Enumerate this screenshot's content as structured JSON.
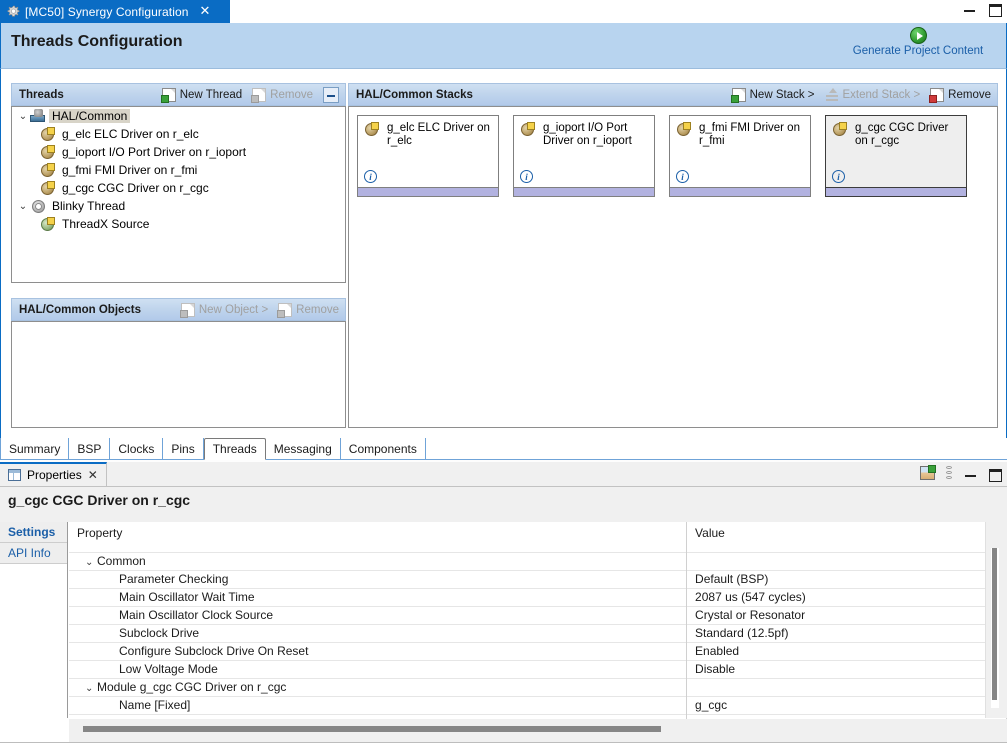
{
  "window": {
    "tab_title": "[MC50] Synergy Configuration",
    "tab_icon": "gear-icon",
    "close_glyph": "✕",
    "minimize_label": "Minimize",
    "maximize_label": "Maximize"
  },
  "header": {
    "title": "Threads Configuration",
    "generate_link": "Generate Project Content",
    "generate_icon": "play-circle-icon"
  },
  "threads_panel": {
    "title": "Threads",
    "new_button": "New Thread",
    "remove_button": "Remove",
    "collapse_button": "collapse",
    "tree": [
      {
        "label": "HAL/Common",
        "level": 0,
        "twisty": "⌄",
        "icon": "hal-common-icon",
        "selected": true
      },
      {
        "label": "g_elc ELC Driver on r_elc",
        "level": 1,
        "twisty": "",
        "icon": "module-icon",
        "selected": false
      },
      {
        "label": "g_ioport I/O Port Driver on r_ioport",
        "level": 1,
        "twisty": "",
        "icon": "module-icon",
        "selected": false
      },
      {
        "label": "g_fmi FMI Driver on r_fmi",
        "level": 1,
        "twisty": "",
        "icon": "module-icon",
        "selected": false
      },
      {
        "label": "g_cgc CGC Driver on r_cgc",
        "level": 1,
        "twisty": "",
        "icon": "module-icon",
        "selected": false
      },
      {
        "label": "Blinky Thread",
        "level": 0,
        "twisty": "⌄",
        "icon": "thread-icon",
        "selected": false
      },
      {
        "label": "ThreadX Source",
        "level": 1,
        "twisty": "",
        "icon": "module-green-icon",
        "selected": false
      }
    ]
  },
  "objects_panel": {
    "title": "HAL/Common Objects",
    "new_button": "New Object >",
    "remove_button": "Remove",
    "items": []
  },
  "stacks_panel": {
    "title": "HAL/Common Stacks",
    "new_button": "New Stack >",
    "extend_button": "Extend Stack >",
    "remove_button": "Remove",
    "boxes": [
      {
        "label": "g_elc ELC Driver on r_elc",
        "selected": false,
        "info_glyph": "i"
      },
      {
        "label": "g_ioport I/O Port Driver on r_ioport",
        "selected": false,
        "info_glyph": "i"
      },
      {
        "label": "g_fmi FMI Driver on r_fmi",
        "selected": false,
        "info_glyph": "i"
      },
      {
        "label": "g_cgc CGC Driver on r_cgc",
        "selected": true,
        "info_glyph": "i"
      }
    ]
  },
  "config_tabs": [
    {
      "label": "Summary",
      "active": false
    },
    {
      "label": "BSP",
      "active": false
    },
    {
      "label": "Clocks",
      "active": false
    },
    {
      "label": "Pins",
      "active": false
    },
    {
      "label": "Threads",
      "active": true
    },
    {
      "label": "Messaging",
      "active": false
    },
    {
      "label": "Components",
      "active": false
    }
  ],
  "properties": {
    "view_tab": "Properties",
    "view_tab_icon": "table-icon",
    "close_glyph": "✕",
    "toolbar": {
      "pin_icon": "pin-view-icon",
      "menu_icon": "view-menu-icon",
      "minimize_icon": "minimize-icon",
      "maximize_icon": "maximize-icon"
    },
    "title": "g_cgc CGC Driver on r_cgc",
    "side_tabs": [
      {
        "label": "Settings",
        "active": true
      },
      {
        "label": "API Info",
        "active": false
      }
    ],
    "columns": [
      "Property",
      "Value"
    ],
    "rows": [
      {
        "kind": "group",
        "twisty": "⌄",
        "property": "Common",
        "value": ""
      },
      {
        "kind": "leaf",
        "twisty": "",
        "property": "Parameter Checking",
        "value": "Default (BSP)"
      },
      {
        "kind": "leaf",
        "twisty": "",
        "property": "Main Oscillator Wait Time",
        "value": "2087 us (547 cycles)"
      },
      {
        "kind": "leaf",
        "twisty": "",
        "property": "Main Oscillator Clock Source",
        "value": "Crystal or Resonator"
      },
      {
        "kind": "leaf",
        "twisty": "",
        "property": "Subclock Drive",
        "value": "Standard (12.5pf)"
      },
      {
        "kind": "leaf",
        "twisty": "",
        "property": "Configure Subclock Drive On Reset",
        "value": "Enabled"
      },
      {
        "kind": "leaf",
        "twisty": "",
        "property": "Low Voltage Mode",
        "value": "Disable"
      },
      {
        "kind": "group",
        "twisty": "⌄",
        "property": "Module g_cgc CGC Driver on r_cgc",
        "value": ""
      },
      {
        "kind": "leaf",
        "twisty": "",
        "property": "Name [Fixed]",
        "value": "g_cgc"
      }
    ]
  },
  "colors": {
    "accent_blue": "#0a6cc4",
    "header_band": "#b8d4ef",
    "link_blue": "#1b5fa8",
    "section_header": "#bfd4ec",
    "stack_foot": "#b2b2e0",
    "selected_tree": "#d8d4c8"
  }
}
